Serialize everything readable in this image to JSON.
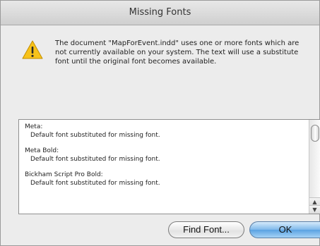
{
  "dialog": {
    "title": "Missing Fonts",
    "icon": "warning-icon",
    "message": "The document \"MapForEvent.indd\" uses one or more fonts which are not currently available on your system. The text will use a substitute font until the original font becomes available."
  },
  "missing_fonts": [
    {
      "name": "Meta:",
      "note": "Default font substituted for missing font."
    },
    {
      "name": "Meta Bold:",
      "note": "Default font substituted for missing font."
    },
    {
      "name": "Bickham Script Pro Bold:",
      "note": "Default font substituted for missing font."
    }
  ],
  "scrollbar": {
    "up_arrow": "▲",
    "down_arrow": "▼"
  },
  "buttons": {
    "find_font": "Find Font...",
    "ok": "OK"
  },
  "colors": {
    "default_button": "#6aaee6",
    "warning_icon": "#f7c21a"
  }
}
